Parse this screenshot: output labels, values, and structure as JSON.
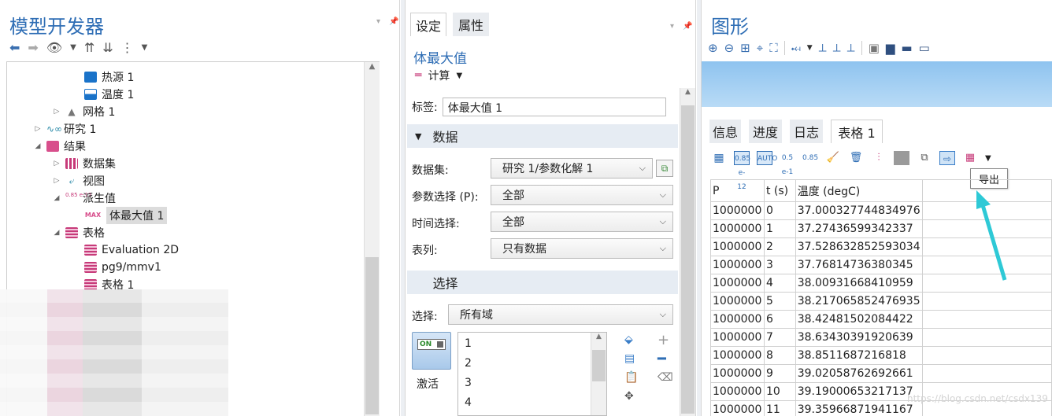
{
  "left": {
    "title": "模型开发器",
    "tree": [
      {
        "label": "热源 1",
        "icon": "heat-source-icon"
      },
      {
        "label": "温度 1",
        "icon": "temperature-icon"
      },
      {
        "label": "网格 1",
        "icon": "mesh-icon"
      },
      {
        "label": "研究 1",
        "icon": "study-icon"
      },
      {
        "label": "结果",
        "icon": "results-icon"
      },
      {
        "label": "数据集",
        "icon": "datasets-icon"
      },
      {
        "label": "视图",
        "icon": "views-icon"
      },
      {
        "label": "派生值",
        "icon": "derived-values-icon"
      },
      {
        "label": "体最大值 1",
        "icon": "volume-max-icon"
      },
      {
        "label": "表格",
        "icon": "tables-icon"
      },
      {
        "label": "Evaluation 2D",
        "icon": "table-icon"
      },
      {
        "label": "pg9/mmv1",
        "icon": "table-icon"
      },
      {
        "label": "表格 1",
        "icon": "table-icon"
      }
    ],
    "max_icon_text": "MAX",
    "derived_icon_text": "0.85 e-12"
  },
  "mid": {
    "tabs": [
      "设定",
      "属性"
    ],
    "node_title": "体最大值",
    "calc_label": "计算",
    "label_prefix": "标签:",
    "label_value": "体最大值 1",
    "section_data": "数据",
    "dataset_label": "数据集:",
    "dataset_value": "研究 1/参数化解 1",
    "param_label": "参数选择 (P):",
    "param_value": "全部",
    "time_label": "时间选择:",
    "time_value": "全部",
    "series_label": "表列:",
    "series_value": "只有数据",
    "section_selection": "选择",
    "selection_label": "选择:",
    "selection_value": "所有域",
    "toggle_text": "ON",
    "activate_label": "激活",
    "selection_items": [
      "1",
      "2",
      "3",
      "4"
    ]
  },
  "right": {
    "title": "图形",
    "tabs": [
      "信息",
      "进度",
      "日志",
      "表格 1"
    ],
    "tooltip": "导出",
    "toolbar_text": {
      "auto": "AUTO",
      "sci": "0.85 e-12",
      "exp": "0.5 e-1",
      "fix": "0.85"
    },
    "headers": [
      "P",
      "t (s)",
      "温度 (degC)"
    ],
    "rows": [
      [
        "1000000",
        "0",
        "37.000327744834976"
      ],
      [
        "1000000",
        "1",
        "37.27436599342337"
      ],
      [
        "1000000",
        "2",
        "37.528632852593034"
      ],
      [
        "1000000",
        "3",
        "37.76814736380345"
      ],
      [
        "1000000",
        "4",
        "38.00931668410959"
      ],
      [
        "1000000",
        "5",
        "38.217065852476935"
      ],
      [
        "1000000",
        "6",
        "38.42481502084422"
      ],
      [
        "1000000",
        "7",
        "38.63430391920639"
      ],
      [
        "1000000",
        "8",
        "38.8511687216818"
      ],
      [
        "1000000",
        "9",
        "39.02058762692661"
      ],
      [
        "1000000",
        "10",
        "39.19000653217137"
      ],
      [
        "1000000",
        "11",
        "39.35966871941167"
      ]
    ],
    "watermark": "https://blog.csdn.net/csdx139"
  },
  "colors": {
    "accent": "#2f6eb5",
    "arrow": "#2ec9d6"
  }
}
